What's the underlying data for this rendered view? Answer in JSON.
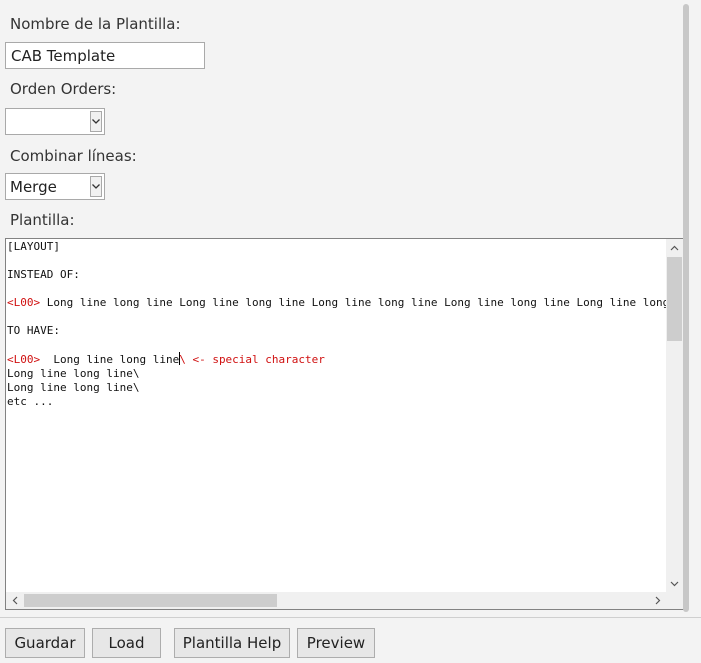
{
  "form": {
    "template_name_label": "Nombre de la Plantilla:",
    "template_name_value": "CAB Template",
    "orders_label": "Orden Orders:",
    "orders_value": "",
    "combine_label": "Combinar líneas:",
    "combine_value": "Merge",
    "template_label": "Plantilla:"
  },
  "editor": {
    "line1": "[LAYOUT]",
    "line3": "INSTEAD OF:",
    "line5_tag": "<L00>",
    "line5_text": " Long line long line Long line long line Long line long line Long line long line Long line long line Long line long line",
    "line7": "TO HAVE:",
    "line9_tag": "<L00>",
    "line9_text": "  Long line long line",
    "line9_mark": "\\ <- special character",
    "line10": "Long line long line\\",
    "line11": "Long line long line\\",
    "line12": "etc ..."
  },
  "buttons": {
    "save": "Guardar",
    "load": "Load",
    "help": "Plantilla Help",
    "preview": "Preview"
  },
  "colors": {
    "highlight": "#d01010",
    "background": "#f3f3f3"
  }
}
